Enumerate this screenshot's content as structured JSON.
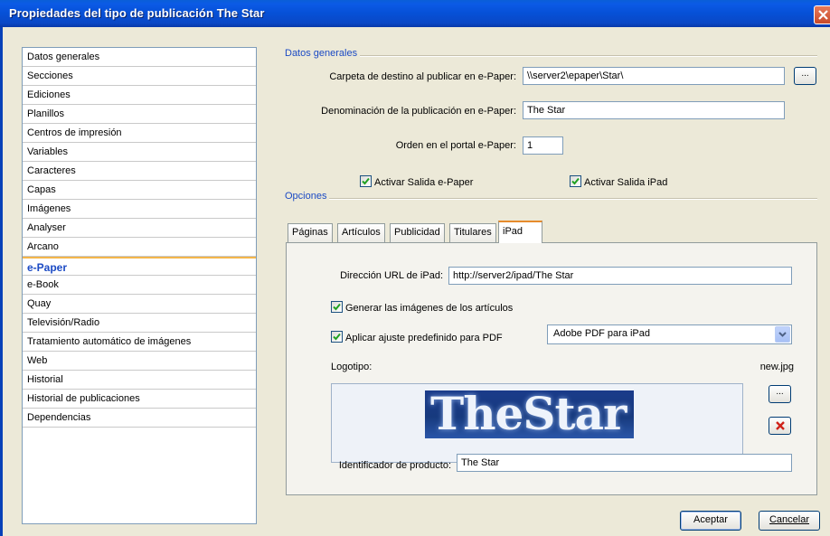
{
  "window": {
    "title": "Propiedades del tipo de publicación  The Star"
  },
  "sidebar": {
    "items": [
      {
        "label": "Datos generales"
      },
      {
        "label": "Secciones"
      },
      {
        "label": "Ediciones"
      },
      {
        "label": "Planillos"
      },
      {
        "label": "Centros de impresión"
      },
      {
        "label": "Variables"
      },
      {
        "label": "Caracteres"
      },
      {
        "label": "Capas"
      },
      {
        "label": "Imágenes"
      },
      {
        "label": "Analyser"
      },
      {
        "label": "Arcano"
      },
      {
        "label": "e-Paper"
      },
      {
        "label": "e-Book"
      },
      {
        "label": "Quay"
      },
      {
        "label": "Televisión/Radio"
      },
      {
        "label": "Tratamiento automático de imágenes"
      },
      {
        "label": "Web"
      },
      {
        "label": "Historial"
      },
      {
        "label": "Historial de publicaciones"
      },
      {
        "label": "Dependencias"
      }
    ],
    "selected": "e-Paper"
  },
  "general": {
    "section_label": "Datos generales",
    "dest_folder_label": "Carpeta de destino al publicar en e-Paper:",
    "dest_folder_value": "\\\\server2\\epaper\\Star\\",
    "browse_label": "...",
    "pub_name_label": "Denominación de la publicación en e-Paper:",
    "pub_name_value": "The Star",
    "order_label": "Orden en el portal e-Paper:",
    "order_value": "1",
    "epaper_output_label": "Activar Salida e-Paper",
    "ipad_output_label": "Activar Salida iPad"
  },
  "options": {
    "section_label": "Opciones",
    "tabs": [
      {
        "label": "Páginas"
      },
      {
        "label": "Artículos"
      },
      {
        "label": "Publicidad"
      },
      {
        "label": "Titulares"
      },
      {
        "label": "iPad"
      }
    ],
    "ipad": {
      "url_label": "Dirección URL de iPad:",
      "url_value": "http://server2/ipad/The Star",
      "gen_images_label": "Generar las imágenes de los artículos",
      "pdf_preset_label": "Aplicar ajuste predefinido para PDF",
      "pdf_preset_value": "Adobe PDF para iPad",
      "logo_label": "Logotipo:",
      "logo_file": "new.jpg",
      "logo_text": "TheStar",
      "browse_label": "...",
      "product_id_label": "Identificador de producto:",
      "product_id_value": "The Star"
    }
  },
  "footer": {
    "accept_label": "Aceptar",
    "cancel_label": "Cancelar"
  },
  "colors": {
    "title_bar": "#0a5fd8",
    "accent": "#1b4ac4",
    "selected_tab_edge": "#e68b2c"
  },
  "icons": {
    "close": "close-icon",
    "check": "checkmark-icon",
    "dropdown": "chevron-down-icon",
    "delete": "red-x-icon"
  }
}
